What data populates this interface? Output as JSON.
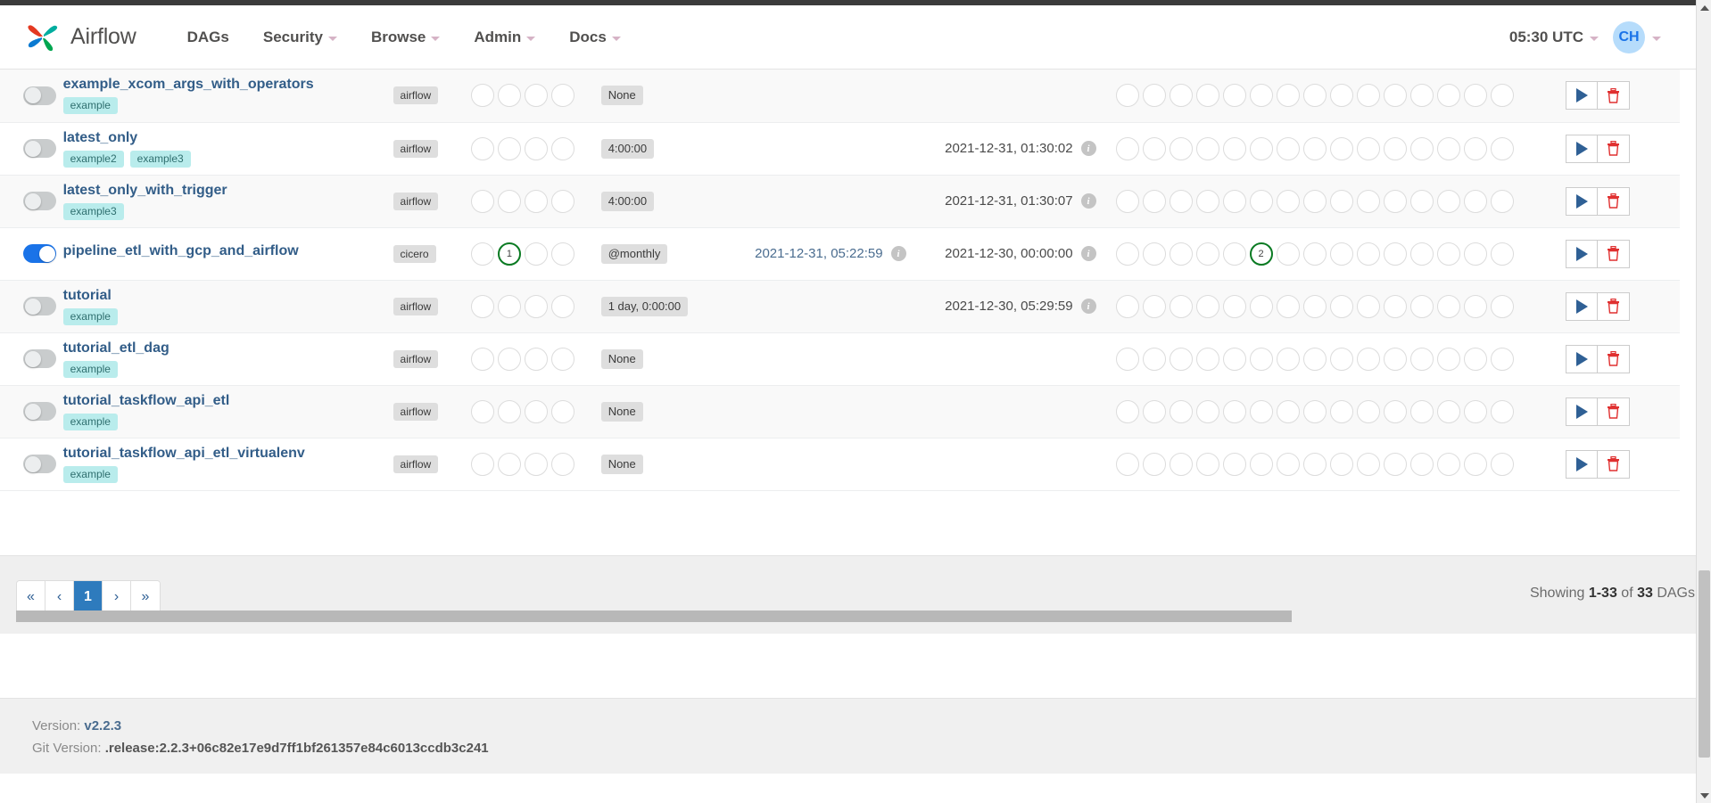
{
  "navbar": {
    "brand": "Airflow",
    "logo_icon": "airflow-pinwheel-logo",
    "items": [
      {
        "label": "DAGs",
        "caret": false
      },
      {
        "label": "Security",
        "caret": true
      },
      {
        "label": "Browse",
        "caret": true
      },
      {
        "label": "Admin",
        "caret": true
      },
      {
        "label": "Docs",
        "caret": true
      }
    ],
    "clock": "05:30 UTC",
    "avatar_initials": "CH"
  },
  "table": {
    "rows": [
      {
        "name": "example_xcom_args_with_operators",
        "enabled": false,
        "tags": [
          "example"
        ],
        "owner": "airflow",
        "recent_tasks": [
          null,
          null,
          null,
          null
        ],
        "schedule": "None",
        "last_run": "",
        "next_run": "",
        "runs": [
          null,
          null,
          null,
          null,
          null,
          null,
          null,
          null,
          null,
          null,
          null,
          null,
          null,
          null,
          null
        ]
      },
      {
        "name": "latest_only",
        "enabled": false,
        "tags": [
          "example2",
          "example3"
        ],
        "owner": "airflow",
        "recent_tasks": [
          null,
          null,
          null,
          null
        ],
        "schedule": "4:00:00",
        "last_run": "",
        "next_run": "2021-12-31, 01:30:02",
        "runs": [
          null,
          null,
          null,
          null,
          null,
          null,
          null,
          null,
          null,
          null,
          null,
          null,
          null,
          null,
          null
        ]
      },
      {
        "name": "latest_only_with_trigger",
        "enabled": false,
        "tags": [
          "example3"
        ],
        "owner": "airflow",
        "recent_tasks": [
          null,
          null,
          null,
          null
        ],
        "schedule": "4:00:00",
        "last_run": "",
        "next_run": "2021-12-31, 01:30:07",
        "runs": [
          null,
          null,
          null,
          null,
          null,
          null,
          null,
          null,
          null,
          null,
          null,
          null,
          null,
          null,
          null
        ]
      },
      {
        "name": "pipeline_etl_with_gcp_and_airflow",
        "enabled": true,
        "tags": [],
        "owner": "cicero",
        "recent_tasks": [
          null,
          "1",
          null,
          null
        ],
        "schedule": "@monthly",
        "last_run": "2021-12-31, 05:22:59",
        "next_run": "2021-12-30, 00:00:00",
        "runs": [
          null,
          null,
          null,
          null,
          null,
          "2",
          null,
          null,
          null,
          null,
          null,
          null,
          null,
          null,
          null
        ]
      },
      {
        "name": "tutorial",
        "enabled": false,
        "tags": [
          "example"
        ],
        "owner": "airflow",
        "recent_tasks": [
          null,
          null,
          null,
          null
        ],
        "schedule": "1 day, 0:00:00",
        "last_run": "",
        "next_run": "2021-12-30, 05:29:59",
        "runs": [
          null,
          null,
          null,
          null,
          null,
          null,
          null,
          null,
          null,
          null,
          null,
          null,
          null,
          null,
          null
        ]
      },
      {
        "name": "tutorial_etl_dag",
        "enabled": false,
        "tags": [
          "example"
        ],
        "owner": "airflow",
        "recent_tasks": [
          null,
          null,
          null,
          null
        ],
        "schedule": "None",
        "last_run": "",
        "next_run": "",
        "runs": [
          null,
          null,
          null,
          null,
          null,
          null,
          null,
          null,
          null,
          null,
          null,
          null,
          null,
          null,
          null
        ]
      },
      {
        "name": "tutorial_taskflow_api_etl",
        "enabled": false,
        "tags": [
          "example"
        ],
        "owner": "airflow",
        "recent_tasks": [
          null,
          null,
          null,
          null
        ],
        "schedule": "None",
        "last_run": "",
        "next_run": "",
        "runs": [
          null,
          null,
          null,
          null,
          null,
          null,
          null,
          null,
          null,
          null,
          null,
          null,
          null,
          null,
          null
        ]
      },
      {
        "name": "tutorial_taskflow_api_etl_virtualenv",
        "enabled": false,
        "tags": [
          "example"
        ],
        "owner": "airflow",
        "recent_tasks": [
          null,
          null,
          null,
          null
        ],
        "schedule": "None",
        "last_run": "",
        "next_run": "",
        "runs": [
          null,
          null,
          null,
          null,
          null,
          null,
          null,
          null,
          null,
          null,
          null,
          null,
          null,
          null,
          null
        ]
      }
    ],
    "action_icons": [
      "trigger-play-icon",
      "delete-trash-icon"
    ]
  },
  "pagination": {
    "first": "«",
    "prev": "‹",
    "pages": [
      "1"
    ],
    "next": "›",
    "last": "»",
    "active_page": "1",
    "showing_prefix": "Showing ",
    "showing_range": "1-33",
    "showing_middle": " of ",
    "showing_total": "33",
    "showing_suffix": " DAGs"
  },
  "footer": {
    "version_label": "Version: ",
    "version_value": "v2.2.3",
    "git_label": "Git Version: ",
    "git_value": ".release:2.2.3+06c82e17e9d7ff1bf261357e84c6013ccdb3c241"
  },
  "colors": {
    "accent_blue": "#1a73e8",
    "link_blue": "#325d88",
    "success_green": "#0a7a22",
    "tag_teal": "#b9ecec",
    "pager_active": "#2e7bbd",
    "delete_red": "#e03131"
  }
}
